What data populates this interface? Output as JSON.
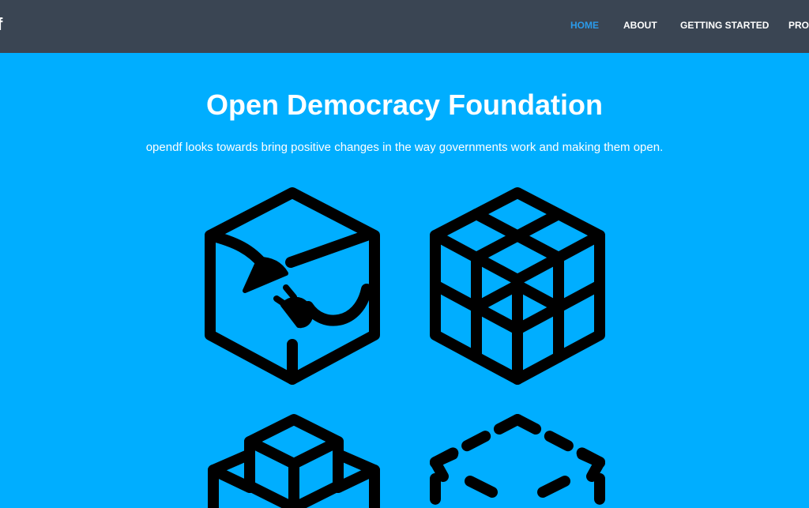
{
  "header": {
    "brand": "f",
    "nav": [
      {
        "label": "HOME",
        "active": true
      },
      {
        "label": "ABOUT",
        "active": false
      },
      {
        "label": "GETTING STARTED",
        "active": false
      },
      {
        "label": "PROJ",
        "active": false
      }
    ]
  },
  "hero": {
    "title": "Open Democracy Foundation",
    "subtitle": "opendf looks towards bring positive changes in the way governments work and making them open."
  },
  "icons": [
    "plug-cube-icon",
    "cube-grid-icon",
    "stacked-cubes-icon",
    "dashed-cube-icon"
  ],
  "colors": {
    "nav_bg": "#3a4553",
    "page_bg": "#00aeff",
    "nav_active": "#2b9bea",
    "text": "#ffffff",
    "icon_stroke": "#000000"
  }
}
